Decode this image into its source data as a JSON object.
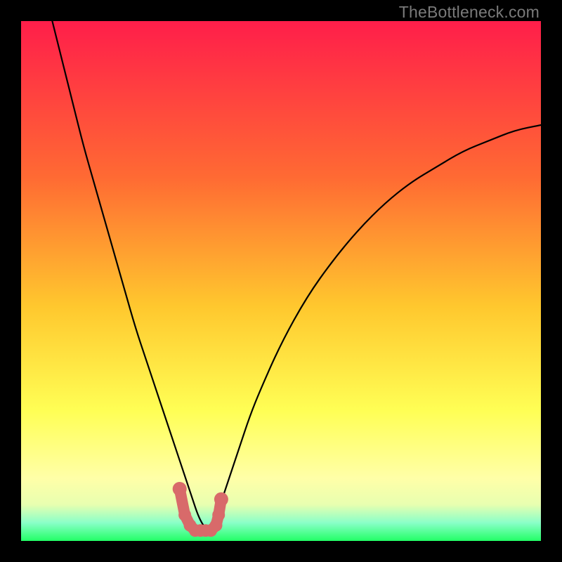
{
  "watermark": "TheBottleneck.com",
  "colors": {
    "bg_black": "#000000",
    "gradient_top": "#ff1e4a",
    "gradient_mid1": "#ff8a2a",
    "gradient_mid2": "#ffd92e",
    "gradient_mid3": "#ffff66",
    "gradient_bottom": "#2aff6a",
    "curve": "#000000",
    "marker_fill": "#d86a6a",
    "marker_stroke": "#b84f4f"
  },
  "chart_data": {
    "type": "line",
    "title": "",
    "xlabel": "",
    "ylabel": "",
    "xlim": [
      0,
      100
    ],
    "ylim": [
      0,
      100
    ],
    "annotations": [],
    "legend": [],
    "series": [
      {
        "name": "bottleneck-curve",
        "x": [
          6,
          8,
          10,
          12,
          14,
          16,
          18,
          20,
          22,
          24,
          26,
          28,
          30,
          31,
          32,
          33,
          34,
          35,
          36,
          37,
          38,
          40,
          42,
          44,
          46,
          50,
          55,
          60,
          65,
          70,
          75,
          80,
          85,
          90,
          95,
          100
        ],
        "values": [
          100,
          92,
          84,
          76,
          69,
          62,
          55,
          48,
          41,
          35,
          29,
          23,
          17,
          14,
          11,
          8,
          5,
          3,
          2,
          3,
          6,
          12,
          18,
          24,
          29,
          38,
          47,
          54,
          60,
          65,
          69,
          72,
          75,
          77,
          79,
          80
        ]
      }
    ],
    "markers": {
      "name": "highlighted-bottom-segment",
      "x": [
        30.5,
        31.5,
        32.5,
        33.5,
        34.5,
        35.5,
        36.5,
        37.5,
        38.0,
        38.5
      ],
      "values": [
        10,
        5,
        3,
        2,
        2,
        2,
        2,
        3,
        5,
        8
      ]
    },
    "background_gradient_stops": [
      {
        "offset": 0.0,
        "color": "#ff1e4a"
      },
      {
        "offset": 0.3,
        "color": "#ff6a33"
      },
      {
        "offset": 0.55,
        "color": "#ffc82e"
      },
      {
        "offset": 0.75,
        "color": "#ffff55"
      },
      {
        "offset": 0.88,
        "color": "#ffffa8"
      },
      {
        "offset": 0.93,
        "color": "#e8ffb0"
      },
      {
        "offset": 0.965,
        "color": "#8affc8"
      },
      {
        "offset": 1.0,
        "color": "#22ff66"
      }
    ]
  }
}
